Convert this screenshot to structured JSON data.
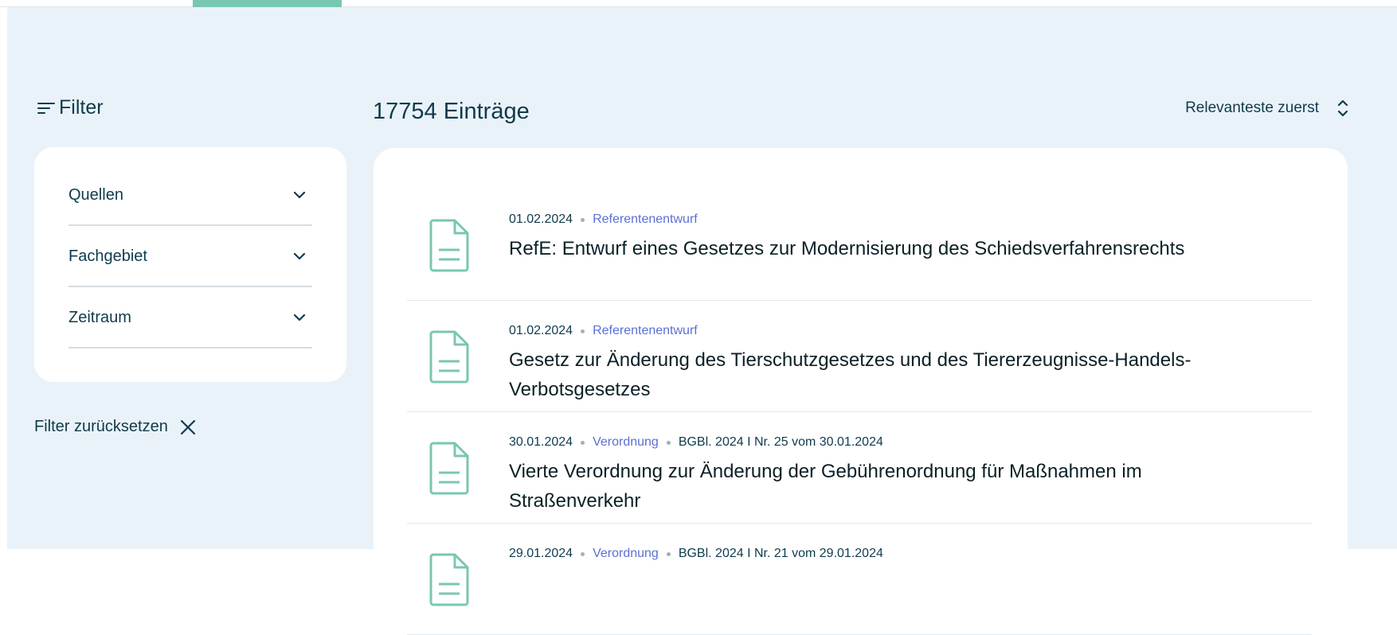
{
  "filter": {
    "title": "Filter",
    "sections": [
      {
        "label": "Quellen"
      },
      {
        "label": "Fachgebiet"
      },
      {
        "label": "Zeitraum"
      }
    ],
    "reset_label": "Filter zurücksetzen"
  },
  "results": {
    "count_label": "17754 Einträge",
    "sort_label": "Relevanteste zuerst",
    "items": [
      {
        "date": "01.02.2024",
        "type": "Referentenentwurf",
        "reference": "",
        "title": "RefE: Entwurf eines Gesetzes zur Modernisierung des Schiedsverfahrensrechts"
      },
      {
        "date": "01.02.2024",
        "type": "Referentenentwurf",
        "reference": "",
        "title": "Gesetz zur Änderung des Tierschutzgesetzes und des Tiererzeugnisse-Handels-Verbotsgesetzes"
      },
      {
        "date": "30.01.2024",
        "type": "Verordnung",
        "reference": "BGBl. 2024 I Nr. 25 vom 30.01.2024",
        "title": "Vierte Verordnung zur Änderung der Gebührenordnung für Maßnahmen im Straßenverkehr"
      },
      {
        "date": "29.01.2024",
        "type": "Verordnung",
        "reference": "BGBl. 2024 I Nr. 21 vom 29.01.2024",
        "title": ""
      }
    ]
  },
  "colors": {
    "background": "#eaf2f9",
    "card": "#ffffff",
    "text_primary": "#0f3b4b",
    "accent_teal": "#78c7b3",
    "type_link": "#5b6fd6"
  },
  "icons": {
    "filter": "filter-lines-icon",
    "chevron": "chevron-down-icon",
    "close": "close-icon",
    "sort": "sort-up-down-icon",
    "document": "document-icon"
  }
}
